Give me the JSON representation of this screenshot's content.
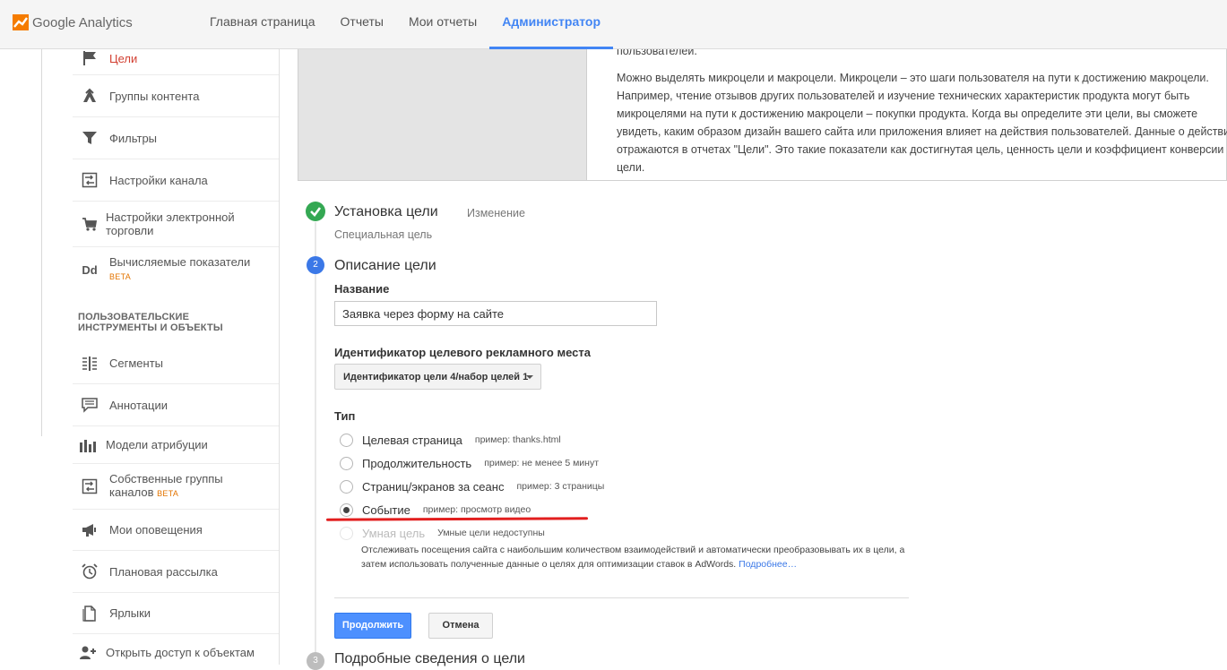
{
  "app": {
    "logo_text": "Google Analytics"
  },
  "nav": {
    "items": [
      {
        "label": "Главная страница"
      },
      {
        "label": "Отчеты"
      },
      {
        "label": "Мои отчеты"
      },
      {
        "label": "Администратор"
      }
    ],
    "active_index": 3
  },
  "sidebar": {
    "items": [
      {
        "label": "Цели",
        "icon": "flag-icon",
        "active": true
      },
      {
        "label": "Группы контента",
        "icon": "content-group-icon"
      },
      {
        "label": "Фильтры",
        "icon": "filter-icon"
      },
      {
        "label": "Настройки канала",
        "icon": "channel-settings-icon"
      },
      {
        "label": "Настройки электронной торговли",
        "icon": "cart-icon"
      },
      {
        "label": "Вычисляемые показатели",
        "icon": "dd-icon",
        "badge": "BETA"
      }
    ],
    "section_title": "ПОЛЬЗОВАТЕЛЬСКИЕ ИНСТРУМЕНТЫ И ОБЪЕКТЫ",
    "tools": [
      {
        "label": "Сегменты",
        "icon": "segments-icon"
      },
      {
        "label": "Аннотации",
        "icon": "annotation-icon"
      },
      {
        "label": "Модели атрибуции",
        "icon": "bar-chart-icon"
      },
      {
        "label": "Собственные группы каналов",
        "icon": "channel-group-icon",
        "badge": "BETA"
      },
      {
        "label": "Мои оповещения",
        "icon": "megaphone-icon"
      },
      {
        "label": "Плановая рассылка",
        "icon": "alarm-clock-icon"
      },
      {
        "label": "Ярлыки",
        "icon": "shortcut-icon"
      },
      {
        "label": "Открыть доступ к объектам",
        "icon": "share-user-icon"
      }
    ]
  },
  "info": {
    "clipped_line": "пользователей.",
    "lines": [
      "Можно выделять микроцели и макроцели. Микроцели – это шаги пользователя на пути к достижению макроцели.",
      "Например, чтение отзывов других пользователей и изучение технических характеристик продукта могут быть",
      "микроцелями на пути к достижению макроцели – покупки продукта. Когда вы определите эти цели, вы сможете",
      "увидеть, каким образом дизайн вашего сайта или приложения влияет на действия пользователей. Данные о действиях",
      "отражаются в отчетах \"Цели\". Это такие показатели как достигнутая цель, ценность цели и коэффициент конверсии",
      "цели."
    ]
  },
  "step1": {
    "title": "Установка цели",
    "edit_link": "Изменение",
    "subtitle": "Специальная цель"
  },
  "step2": {
    "number": "2",
    "title": "Описание цели",
    "name_label": "Название",
    "name_value": "Заявка через форму на сайте",
    "slot_label": "Идентификатор целевого рекламного места",
    "slot_value": "Идентификатор цели 4/набор целей 1",
    "type_label": "Тип",
    "types": [
      {
        "label": "Целевая страница",
        "hint": "пример: thanks.html",
        "checked": false
      },
      {
        "label": "Продолжительность",
        "hint": "пример: не менее 5 минут",
        "checked": false
      },
      {
        "label": "Страниц/экранов за сеанс",
        "hint": "пример: 3 страницы",
        "checked": false
      },
      {
        "label": "Событие",
        "hint": "пример: просмотр видео",
        "checked": true
      },
      {
        "label": "Умная цель",
        "hint": "Умные цели недоступны",
        "checked": false,
        "disabled": true
      }
    ],
    "smart_desc": "Отслеживать посещения сайта с наибольшим количеством взаимодействий и автоматически преобразовывать их в цели, а затем использовать полученные данные о целях для оптимизации ставок в AdWords.",
    "smart_link": "Подробнее…",
    "continue_label": "Продолжить",
    "cancel_label": "Отмена"
  },
  "step3": {
    "number": "3",
    "title": "Подробные сведения о цели"
  },
  "colors": {
    "accent": "#4285f4",
    "active_sidebar": "#d23f31",
    "success": "#34a853",
    "annotation_red": "#e21e1e"
  }
}
